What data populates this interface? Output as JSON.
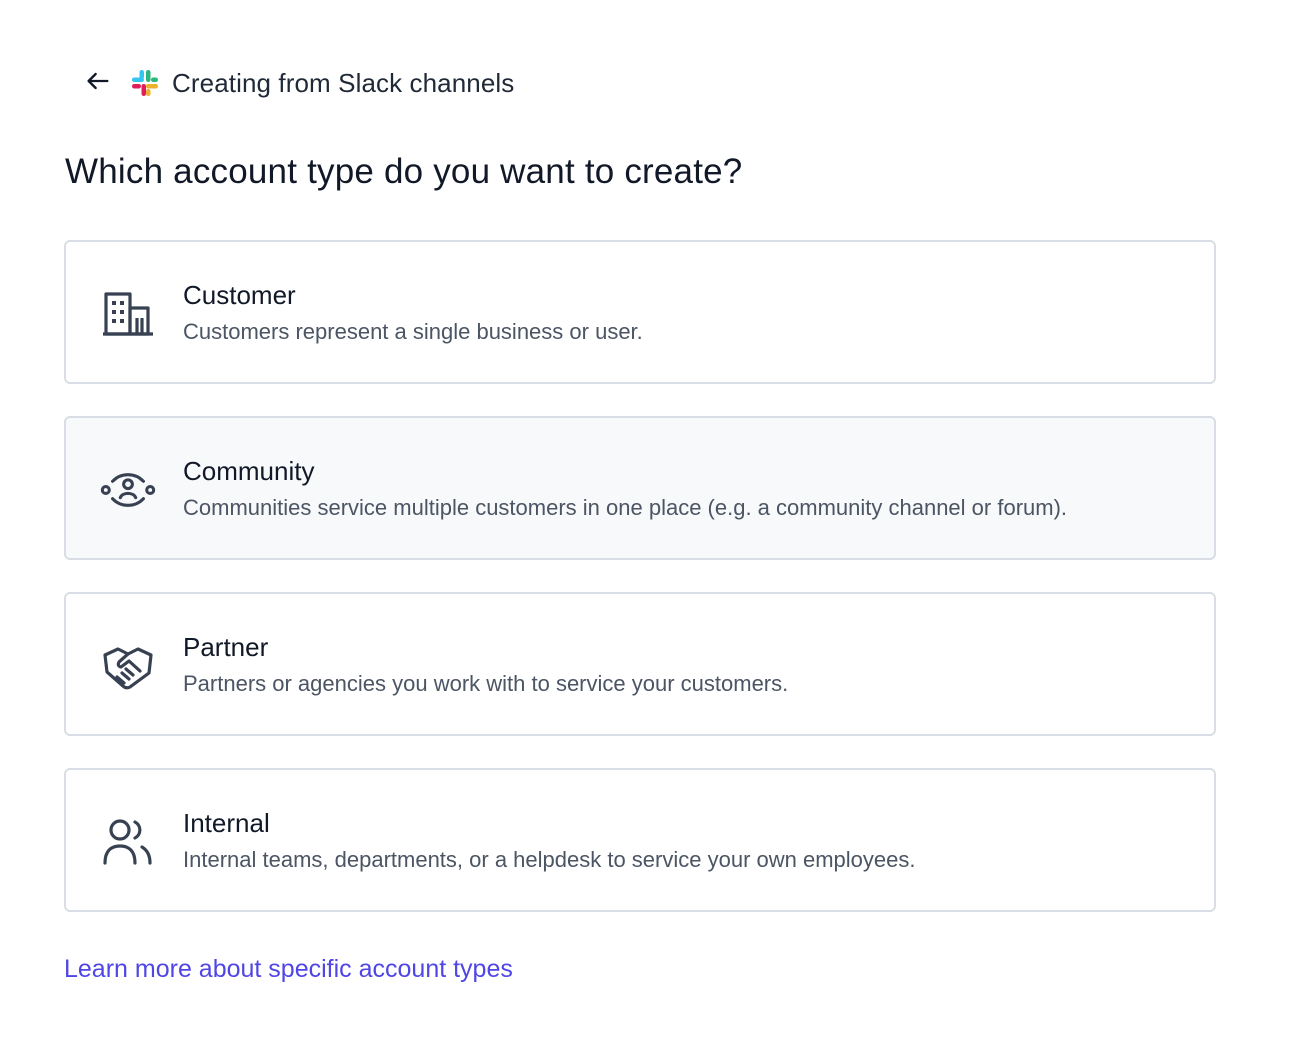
{
  "header": {
    "back_icon": "arrow-left-icon",
    "logo_icon": "slack-logo-icon",
    "title": "Creating from Slack channels"
  },
  "question": "Which account type do you want to create?",
  "account_types": [
    {
      "icon": "building-icon",
      "title": "Customer",
      "description": "Customers represent a single business or user."
    },
    {
      "icon": "community-icon",
      "title": "Community",
      "description": "Communities service multiple customers in one place (e.g. a community channel or forum)."
    },
    {
      "icon": "handshake-icon",
      "title": "Partner",
      "description": "Partners or agencies you work with to service your customers."
    },
    {
      "icon": "users-icon",
      "title": "Internal",
      "description": "Internal teams, departments, or a helpdesk to service your own employees."
    }
  ],
  "learn_more_link": "Learn more about specific account types",
  "colors": {
    "link": "#4f46e5",
    "border": "#d9dee6",
    "hover_background": "#f8f9fb",
    "icon": "#374151"
  }
}
